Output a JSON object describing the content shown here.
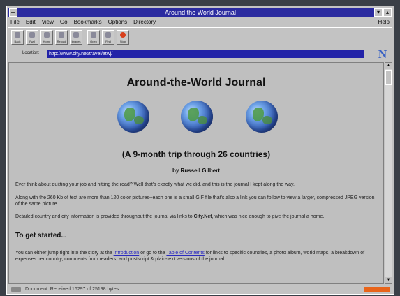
{
  "window": {
    "title": "Around the World Journal",
    "minimize_glyph": "▾",
    "maximize_glyph": "▴"
  },
  "menu": [
    "File",
    "Edit",
    "View",
    "Go",
    "Bookmarks",
    "Options",
    "Directory"
  ],
  "menu_help": "Help",
  "toolbar": {
    "buttons": [
      {
        "label": "Back",
        "icon": "back-arrow-icon"
      },
      {
        "label": "Fwd",
        "icon": "forward-arrow-icon"
      },
      {
        "label": "Home",
        "icon": "home-icon"
      },
      {
        "label": "Reload",
        "icon": "reload-icon"
      },
      {
        "label": "Images",
        "icon": "images-icon"
      },
      {
        "label": "Open",
        "icon": "open-icon"
      },
      {
        "label": "Find",
        "icon": "find-icon"
      },
      {
        "label": "Stop",
        "icon": "stop-icon"
      }
    ]
  },
  "location": {
    "label": "Location:",
    "url": "http://www.city.net/travel/atwj/",
    "logo": "N"
  },
  "page": {
    "title": "Around-the-World Journal",
    "subtitle": "(A 9-month trip through 26 countries)",
    "byline": "by Russell Gilbert",
    "para1": "Ever think about quitting your job and hitting the road? Well that's exactly what we did, and this is the journal I kept along the way.",
    "para2": "Along with the 260 Kb of text are more than 120 color pictures--each one is a small GIF file that's also a link you can follow to view a larger, compressed JPEG version of the same picture.",
    "para3_pre": "Detailed country and city information is provided throughout the journal via links to ",
    "para3_bold": "City.Net",
    "para3_post": ", which was nice enough to give the journal a home.",
    "section_heading": "To get started...",
    "para4_pre": "You can either jump right into the story at the ",
    "link_intro": "Introduction",
    "para4_mid": " or go to the ",
    "link_toc": "Table of Contents",
    "para4_post": " for links to specific countries, a photo album, world maps, a breakdown of expenses per country, comments from readers, and postscript & plain-text versions of the journal."
  },
  "status": {
    "text": "Document: Received 16297 of 25198 bytes"
  },
  "colors": {
    "titlebar": "#2b2ba0",
    "url_field": "#2323a8",
    "link": "#2b2bbf",
    "progress": "#e8641a"
  }
}
